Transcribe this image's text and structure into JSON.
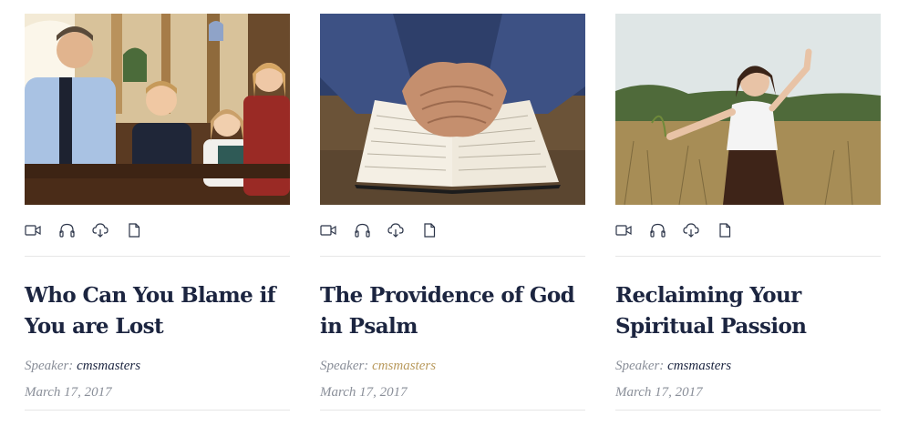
{
  "sermons": [
    {
      "title": "Who Can You Blame if You are Lost",
      "speaker_label": "Speaker:",
      "speaker_name": "cmsmasters",
      "date": "March 17, 2017",
      "icons": [
        "video-icon",
        "headphones-icon",
        "download-icon",
        "document-icon"
      ]
    },
    {
      "title": "The Providence of God in Psalm",
      "speaker_label": "Speaker:",
      "speaker_name": "cmsmasters",
      "date": "March 17, 2017",
      "icons": [
        "video-icon",
        "headphones-icon",
        "download-icon",
        "document-icon"
      ]
    },
    {
      "title": "Reclaiming Your Spiritual Passion",
      "speaker_label": "Speaker:",
      "speaker_name": "cmsmasters",
      "date": "March 17, 2017",
      "icons": [
        "video-icon",
        "headphones-icon",
        "download-icon",
        "document-icon"
      ]
    }
  ],
  "colors": {
    "title": "#1c2540",
    "meta": "#8a8f99",
    "accent_link": "#b99a5d",
    "rule": "#e6e6e6"
  }
}
